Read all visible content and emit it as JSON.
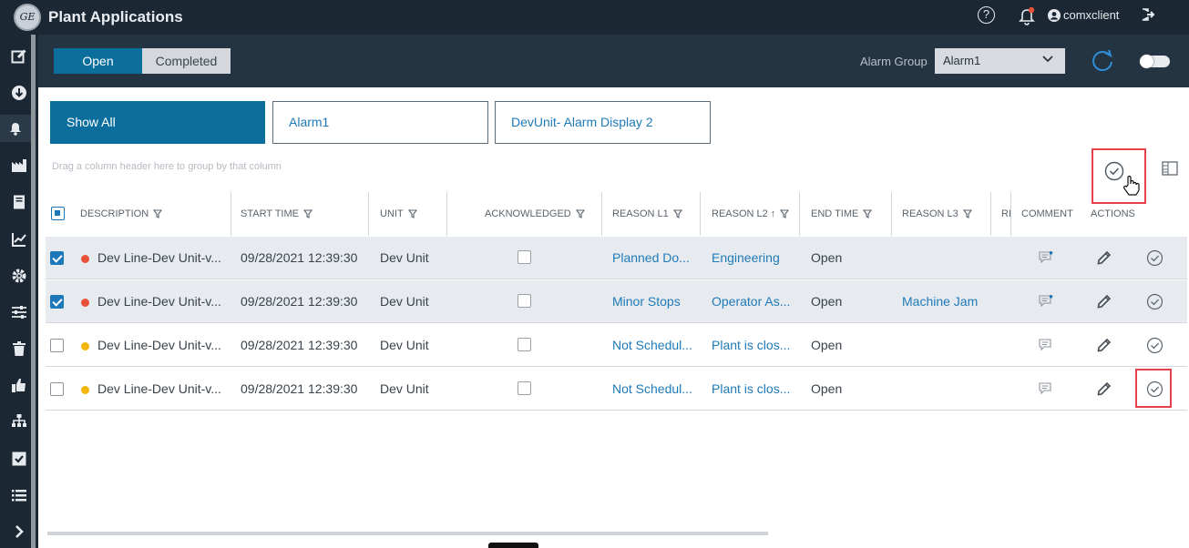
{
  "app": {
    "title": "Plant Applications",
    "logo_text": "GE",
    "username": "comxclient"
  },
  "toolbar": {
    "tabs": [
      {
        "label": "Open",
        "active": true
      },
      {
        "label": "Completed",
        "active": false
      }
    ],
    "alarm_group_label": "Alarm Group",
    "alarm_group_value": "Alarm1"
  },
  "filters": {
    "buttons": [
      {
        "label": "Show All",
        "active": true
      },
      {
        "label": "Alarm1",
        "active": false
      },
      {
        "label": "DevUnit- Alarm Display 2",
        "active": false
      }
    ],
    "group_hint": "Drag a column header here to group by that column"
  },
  "grid": {
    "columns": {
      "description": "DESCRIPTION",
      "start_time": "START TIME",
      "unit": "UNIT",
      "acknowledged": "ACKNOWLEDGED",
      "reason_l1": "REASON L1",
      "reason_l2": "REASON L2",
      "reason_l2_sort": "↑",
      "end_time": "END TIME",
      "reason_l3": "REASON L3",
      "reason_l4_partial": "RE",
      "comment": "COMMENT",
      "actions": "ACTIONS"
    },
    "rows": [
      {
        "selected": true,
        "priority_color": "#e8523a",
        "description": "Dev Line-Dev Unit-v...",
        "start_time": "09/28/2021 12:39:30",
        "unit": "Dev Unit",
        "acknowledged": false,
        "reason_l1": "Planned Do...",
        "reason_l2": "Engineering",
        "end_time": "Open",
        "reason_l3": "",
        "has_comment": true
      },
      {
        "selected": true,
        "priority_color": "#e8523a",
        "description": "Dev Line-Dev Unit-v...",
        "start_time": "09/28/2021 12:39:30",
        "unit": "Dev Unit",
        "acknowledged": false,
        "reason_l1": "Minor Stops",
        "reason_l2": "Operator As...",
        "end_time": "Open",
        "reason_l3": "Machine Jam",
        "has_comment": true
      },
      {
        "selected": false,
        "priority_color": "#f2b705",
        "description": "Dev Line-Dev Unit-v...",
        "start_time": "09/28/2021 12:39:30",
        "unit": "Dev Unit",
        "acknowledged": false,
        "reason_l1": "Not Schedul...",
        "reason_l2": "Plant is clos...",
        "end_time": "Open",
        "reason_l3": "",
        "has_comment": false
      },
      {
        "selected": false,
        "priority_color": "#f2b705",
        "description": "Dev Line-Dev Unit-v...",
        "start_time": "09/28/2021 12:39:30",
        "unit": "Dev Unit",
        "acknowledged": false,
        "reason_l1": "Not Schedul...",
        "reason_l2": "Plant is clos...",
        "end_time": "Open",
        "reason_l3": "",
        "has_comment": false
      }
    ]
  },
  "colors": {
    "primary": "#0c6e9c",
    "link": "#1e7ab8",
    "header_bg": "#1b2733",
    "toolbar_bg": "#243443",
    "highlight": "#e2424b"
  },
  "sidebar_icons": [
    "edit-icon",
    "download-icon",
    "bell-icon",
    "factory-icon",
    "book-icon",
    "line-chart-icon",
    "gear-icon",
    "sliders-icon",
    "trash-icon",
    "thumbs-up-icon",
    "hierarchy-icon",
    "checkbox-icon",
    "list-icon",
    "chevron-right-icon"
  ]
}
